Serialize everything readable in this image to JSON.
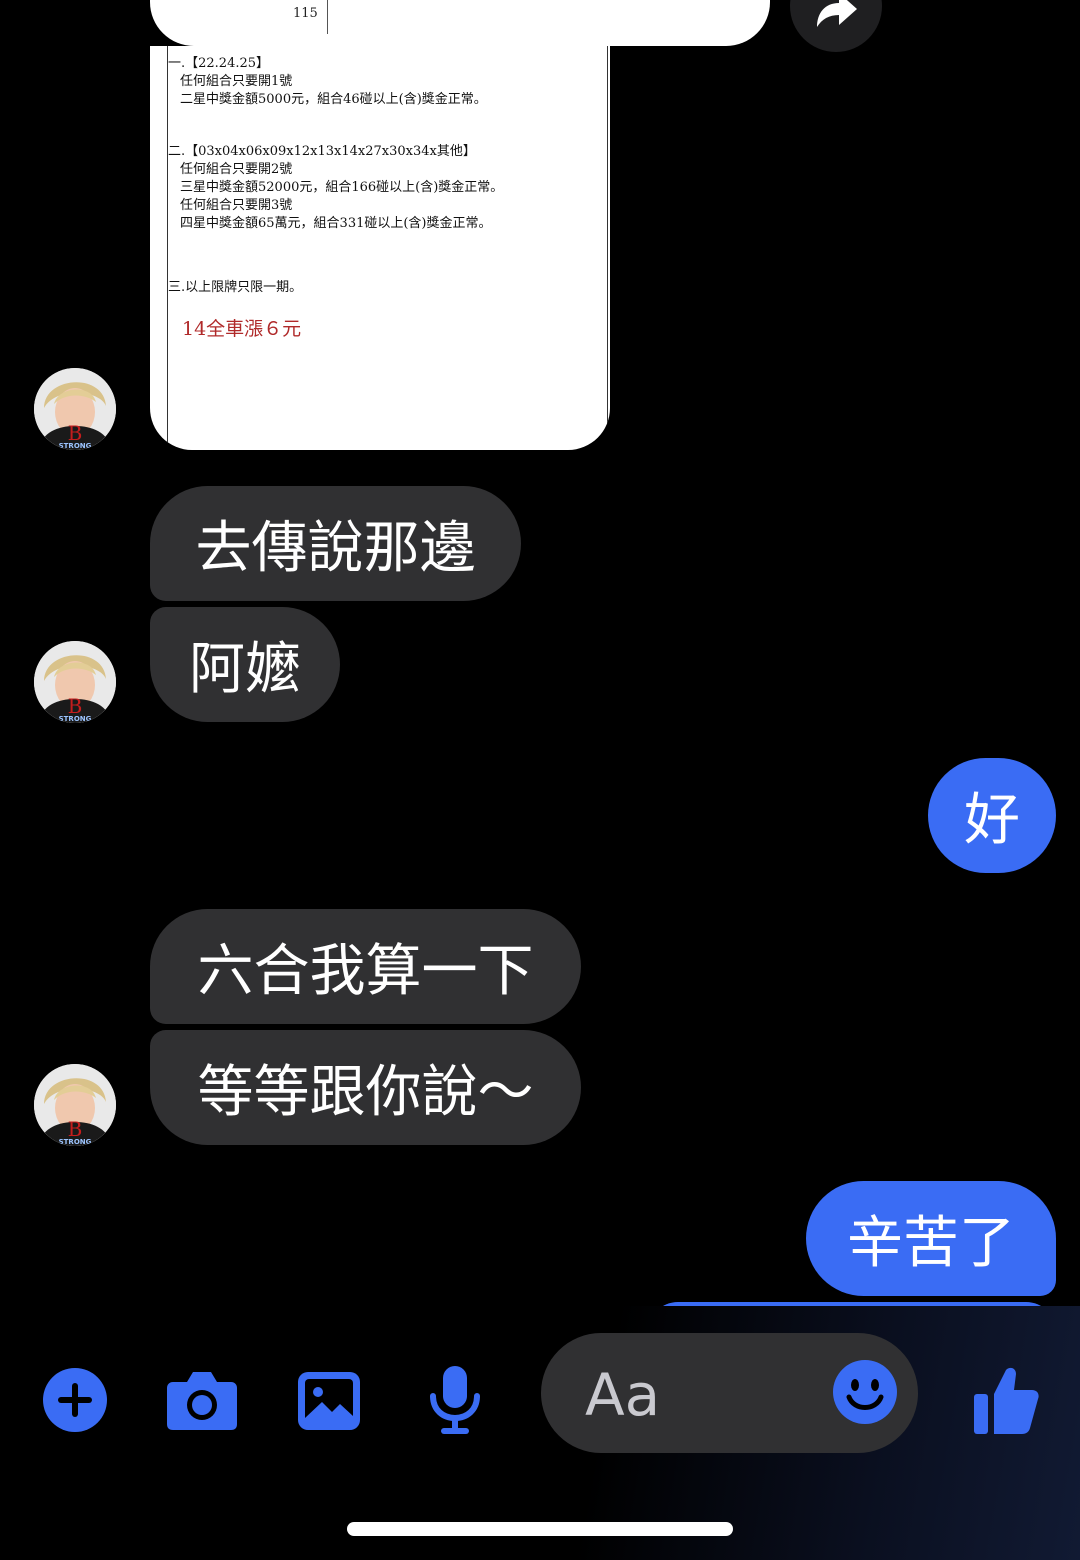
{
  "top_bubble": {
    "page_number": "115"
  },
  "document": {
    "lines": [
      "一.【22.24.25】",
      "任何組合只要開1號",
      "二星中獎金額5000元，組合46碰以上(含)獎金正常。",
      "二.【03x04x06x09x12x13x14x27x30x34x其他】",
      "任何組合只要開2號",
      "三星中獎金額52000元，組合166碰以上(含)獎金正常。",
      "任何組合只要開3號",
      "四星中獎金額65萬元，組合331碰以上(含)獎金正常。",
      "三.以上限牌只限一期。",
      "14全車漲６元"
    ]
  },
  "messages": [
    {
      "side": "in",
      "text": "去傳說那邊"
    },
    {
      "side": "in",
      "text": "阿嬤"
    },
    {
      "side": "out",
      "text": "好"
    },
    {
      "side": "in",
      "text": "六合我算一下"
    },
    {
      "side": "in",
      "text": "等等跟你說～"
    },
    {
      "side": "out",
      "text": "辛苦了"
    }
  ],
  "avatar": {
    "badge_text": "STRONG",
    "letter": "B"
  },
  "composer": {
    "placeholder": "Aa"
  },
  "colors": {
    "accent": "#3a6cf4",
    "incoming_bubble": "#303032",
    "background": "#000000"
  },
  "icons": [
    "share-icon",
    "plus-icon",
    "camera-icon",
    "gallery-icon",
    "microphone-icon",
    "emoji-icon",
    "thumbs-up-icon"
  ]
}
